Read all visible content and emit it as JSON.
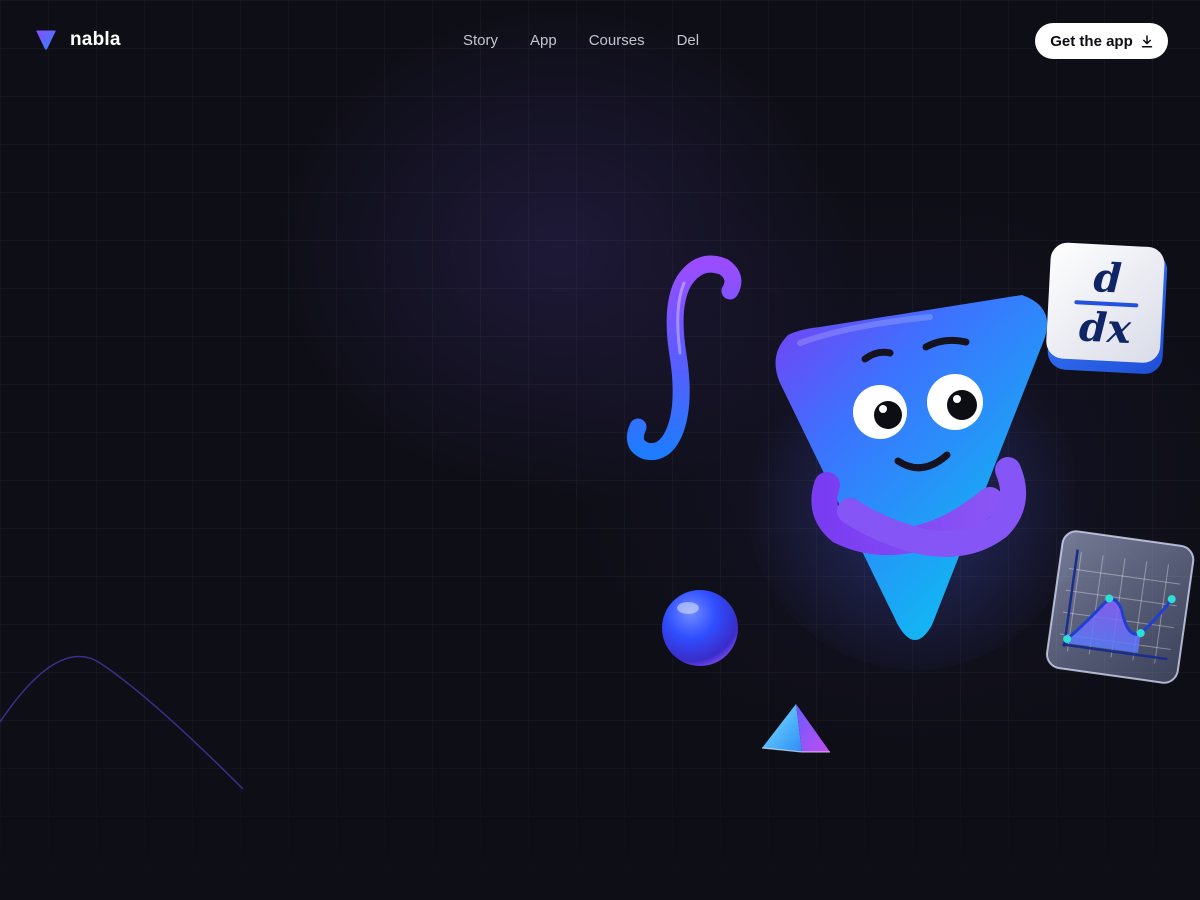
{
  "brand": {
    "name": "nabla",
    "logo_icon": "nabla-triangle-logo-icon"
  },
  "nav": {
    "items": [
      {
        "label": "Story"
      },
      {
        "label": "App"
      },
      {
        "label": "Courses"
      },
      {
        "label": "Del"
      }
    ]
  },
  "cta": {
    "label": "Get the app",
    "icon": "download-icon"
  },
  "hero": {
    "mascot": "nabla-mascot-arms-crossed",
    "derivative_card": {
      "numerator": "d",
      "denominator": "dx"
    },
    "objects": [
      "integral-symbol",
      "glossy-sphere",
      "glass-pyramid",
      "graph-tile",
      "parabola-curve"
    ]
  },
  "colors": {
    "background": "#0e0e16",
    "accent_blue": "#2f7bff",
    "accent_purple": "#7b3cf0",
    "accent_cyan": "#12c4f2",
    "cta_background": "#ffffff",
    "nav_text": "#c4c4cf"
  }
}
